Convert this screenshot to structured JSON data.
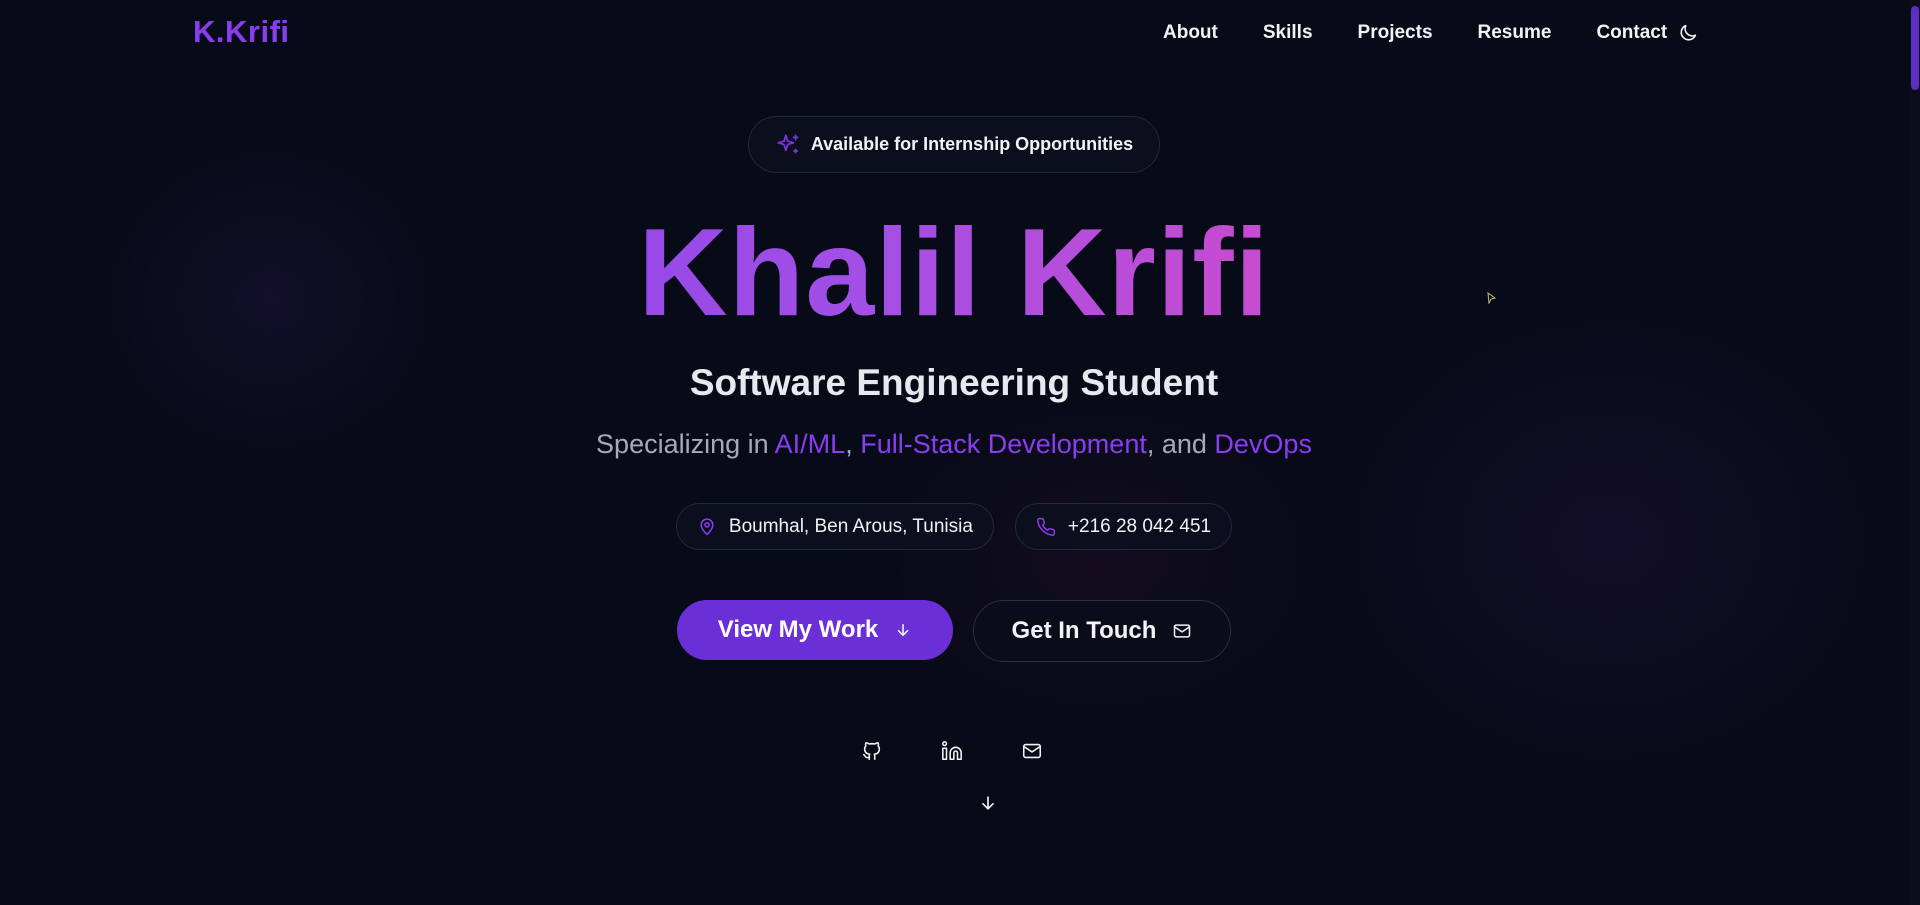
{
  "nav": {
    "logo": "K.Krifi",
    "links": [
      "About",
      "Skills",
      "Projects",
      "Resume",
      "Contact"
    ],
    "theme_toggle_icon": "moon-icon"
  },
  "hero": {
    "badge_icon": "sparkles-icon",
    "badge_text": "Available for Internship Opportunities",
    "name": "Khalil Krifi",
    "role": "Software Engineering Student",
    "specializing_prefix": "Specializing in ",
    "specialties": [
      "AI/ML",
      "Full-Stack Development",
      "DevOps"
    ],
    "sep1": ", ",
    "sep2": ", and ",
    "location": "Boumhal, Ben Arous, Tunisia",
    "phone": "+216 28 042 451",
    "primary_cta": "View My Work",
    "secondary_cta": "Get In Touch"
  },
  "socials": [
    "github-icon",
    "linkedin-icon",
    "mail-icon"
  ],
  "colors": {
    "background": "#070a17",
    "accent": "#8a3df0",
    "button_primary": "#6b2fd8",
    "gradient": [
      "#7a35e8",
      "#a24fe6",
      "#d64bc7",
      "#ee4a8a"
    ]
  }
}
